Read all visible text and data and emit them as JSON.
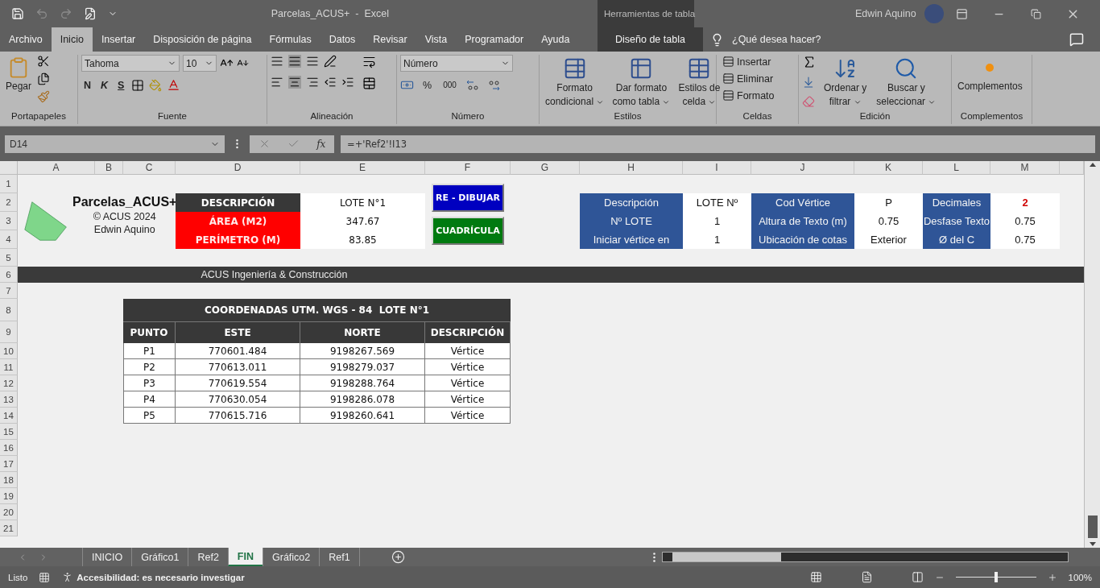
{
  "title_bar": {
    "title": "Parcelas_ACUS+  -  Excel",
    "context_tools": "Herramientas de tabla",
    "user": "Edwin Aquino"
  },
  "menu_tabs": [
    {
      "label": "Archivo",
      "selected": false,
      "kind": "normal"
    },
    {
      "label": "Inicio",
      "selected": true,
      "kind": "normal"
    },
    {
      "label": "Insertar",
      "selected": false,
      "kind": "normal"
    },
    {
      "label": "Disposición de página",
      "selected": false,
      "kind": "normal"
    },
    {
      "label": "Fórmulas",
      "selected": false,
      "kind": "normal"
    },
    {
      "label": "Datos",
      "selected": false,
      "kind": "normal"
    },
    {
      "label": "Revisar",
      "selected": false,
      "kind": "normal"
    },
    {
      "label": "Vista",
      "selected": false,
      "kind": "normal"
    },
    {
      "label": "Programador",
      "selected": false,
      "kind": "normal"
    },
    {
      "label": "Ayuda",
      "selected": false,
      "kind": "normal"
    },
    {
      "label": "Diseño de tabla",
      "selected": false,
      "kind": "contextual"
    }
  ],
  "tell_me": {
    "placeholder": "¿Qué desea hacer?"
  },
  "ribbon": {
    "clipboard": {
      "label": "Portapapeles",
      "paste": "Pegar"
    },
    "font": {
      "label": "Fuente",
      "family": "Tahoma",
      "size": "10",
      "bold": "N",
      "italic": "K",
      "underline": "S"
    },
    "alignment": {
      "label": "Alineación"
    },
    "number": {
      "label": "Número",
      "format": "Número",
      "percent": "%",
      "thousands": "000"
    },
    "styles": {
      "label": "Estilos",
      "buttons": [
        {
          "line1": "Formato",
          "line2": "condicional"
        },
        {
          "line1": "Dar formato",
          "line2": "como tabla"
        },
        {
          "line1": "Estilos de",
          "line2": "celda"
        }
      ]
    },
    "cells": {
      "label": "Celdas",
      "buttons": [
        "Insertar",
        "Eliminar",
        "Formato"
      ]
    },
    "editing": {
      "label": "Edición",
      "buttons": [
        {
          "line1": "Ordenar y",
          "line2": "filtrar"
        },
        {
          "line1": "Buscar y",
          "line2": "seleccionar"
        }
      ]
    },
    "addins": {
      "label": "Complementos",
      "button": "Complementos"
    }
  },
  "formula_bar": {
    "name_box": "D14",
    "fx": "fx",
    "formula": "=+'Ref2'!I13"
  },
  "columns": [
    "A",
    "B",
    "C",
    "D",
    "E",
    "F",
    "G",
    "H",
    "I",
    "J",
    "K",
    "L",
    "M"
  ],
  "rows": [
    "1",
    "2",
    "3",
    "4",
    "5",
    "6",
    "7",
    "8",
    "9",
    "10",
    "11",
    "12",
    "13",
    "14",
    "15",
    "16",
    "17",
    "18",
    "19",
    "20",
    "21"
  ],
  "logo": {
    "title": "Parcelas_ACUS+",
    "copyright": "© ACUS 2024",
    "author": "Edwin Aquino"
  },
  "summary": [
    {
      "label": "DESCRIPCIÓN",
      "value": "LOTE N°1",
      "kind": "header"
    },
    {
      "label": "ÁREA (M2)",
      "value": "347.67",
      "kind": "alert"
    },
    {
      "label": "PERÍMETRO (M)",
      "value": "83.85",
      "kind": "alert"
    }
  ],
  "buttons": [
    {
      "label": "RE - DIBUJAR",
      "color": "#0000c0"
    },
    {
      "label": "CUADRÍCULA",
      "color": "#007a10"
    }
  ],
  "settings": [
    [
      {
        "label": "Descripción",
        "value": "LOTE Nº",
        "highlight": false
      },
      {
        "label": "Cod Vértice",
        "value": "P",
        "highlight": false
      },
      {
        "label": "Decimales",
        "value": "2",
        "highlight": true
      }
    ],
    [
      {
        "label": "Nº LOTE",
        "value": "1",
        "highlight": false
      },
      {
        "label": "Altura de Texto (m)",
        "value": "0.75",
        "highlight": false
      },
      {
        "label": "Desfase Texto",
        "value": "0.75",
        "highlight": false
      }
    ],
    [
      {
        "label": "Iniciar vértice en",
        "value": "1",
        "highlight": false
      },
      {
        "label": "Ubicación de cotas",
        "value": "Exterior",
        "highlight": false
      },
      {
        "label": "Ø del C",
        "value": "0.75",
        "highlight": false
      }
    ]
  ],
  "banner": "ACUS Ingeniería & Construcción",
  "coords": {
    "title": "COORDENADAS UTM. WGS - 84  LOTE N°1",
    "columns": [
      "PUNTO",
      "ESTE",
      "NORTE",
      "DESCRIPCIÓN"
    ],
    "rows": [
      [
        "P1",
        "770601.484",
        "9198267.569",
        "Vértice"
      ],
      [
        "P2",
        "770613.011",
        "9198279.037",
        "Vértice"
      ],
      [
        "P3",
        "770619.554",
        "9198288.764",
        "Vértice"
      ],
      [
        "P4",
        "770630.054",
        "9198286.078",
        "Vértice"
      ],
      [
        "P5",
        "770615.716",
        "9198260.641",
        "Vértice"
      ]
    ]
  },
  "sheet_tabs": [
    {
      "label": "INICIO",
      "selected": false
    },
    {
      "label": "Gráfico1",
      "selected": false
    },
    {
      "label": "Ref2",
      "selected": false
    },
    {
      "label": "FIN",
      "selected": true
    },
    {
      "label": "Gráfico2",
      "selected": false
    },
    {
      "label": "Ref1",
      "selected": false
    }
  ],
  "status_bar": {
    "ready": "Listo",
    "accessibility": "Accesibilidad: es necesario investigar",
    "zoom": {
      "level": 0.5
    },
    "zoom_reading": "100%"
  }
}
